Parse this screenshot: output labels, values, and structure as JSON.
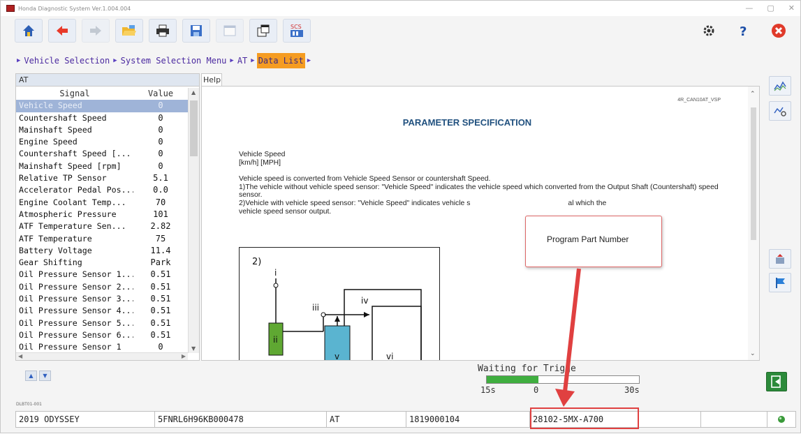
{
  "window": {
    "title": "Honda Diagnostic System Ver.1.004.004"
  },
  "toolbar": {
    "buttons": [
      {
        "name": "home-icon",
        "disabled": false
      },
      {
        "name": "back-arrow-icon",
        "disabled": false
      },
      {
        "name": "forward-arrow-icon",
        "disabled": true
      },
      {
        "name": "open-folder-icon",
        "disabled": false
      },
      {
        "name": "print-icon",
        "disabled": false
      },
      {
        "name": "save-icon",
        "disabled": false
      },
      {
        "name": "window-icon",
        "disabled": true
      },
      {
        "name": "export-icon",
        "disabled": false
      },
      {
        "name": "scs-icon",
        "disabled": false
      }
    ],
    "scs_label": "SCS"
  },
  "breadcrumb": {
    "items": [
      "Vehicle Selection",
      "System Selection Menu",
      "AT",
      "Data List"
    ],
    "active_index": 3
  },
  "signal_panel": {
    "title": "AT",
    "headers": {
      "signal": "Signal",
      "value": "Value"
    },
    "rows": [
      {
        "signal": "Vehicle Speed",
        "value": "0",
        "selected": true
      },
      {
        "signal": "Countershaft Speed",
        "value": "0"
      },
      {
        "signal": "Mainshaft Speed",
        "value": "0"
      },
      {
        "signal": "Engine Speed",
        "value": "0"
      },
      {
        "signal": "Countershaft Speed [...",
        "value": "0"
      },
      {
        "signal": "Mainshaft Speed [rpm]",
        "value": "0"
      },
      {
        "signal": "Relative TP Sensor",
        "value": "5.1"
      },
      {
        "signal": "Accelerator Pedal Pos...",
        "value": "0.0"
      },
      {
        "signal": "Engine Coolant Temp...",
        "value": "70"
      },
      {
        "signal": "Atmospheric Pressure",
        "value": "101"
      },
      {
        "signal": "ATF Temperature Sen...",
        "value": "2.82"
      },
      {
        "signal": "ATF Temperature",
        "value": "75"
      },
      {
        "signal": "Battery Voltage",
        "value": "11.4"
      },
      {
        "signal": "Gear Shifting",
        "value": "Park"
      },
      {
        "signal": "Oil Pressure Sensor 1...",
        "value": "0.51"
      },
      {
        "signal": "Oil Pressure Sensor 2...",
        "value": "0.51"
      },
      {
        "signal": "Oil Pressure Sensor 3...",
        "value": "0.51"
      },
      {
        "signal": "Oil Pressure Sensor 4...",
        "value": "0.51"
      },
      {
        "signal": "Oil Pressure Sensor 5...",
        "value": "0.51"
      },
      {
        "signal": "Oil Pressure Sensor 6...",
        "value": "0.51"
      },
      {
        "signal": "Oil Pressure Sensor 1",
        "value": "0"
      }
    ]
  },
  "help": {
    "tab_label": "Help",
    "doc_code": "4R_CAN10AT_VSP",
    "heading": "PARAMETER SPECIFICATION",
    "param_name": "Vehicle Speed",
    "param_unit": "[km/h] [MPH]",
    "para1": "Vehicle speed is converted from Vehicle Speed Sensor or countershaft Speed.",
    "para2": "1)The vehicle without vehicle speed sensor: \"Vehicle Speed\" indicates the vehicle speed which converted from the Output Shaft (Countershaft) speed sensor.",
    "para3_start": "2)Vehicle with vehicle speed sensor: \"Vehicle Speed\" indicates vehicle s",
    "para3_end": "al which the",
    "para3_line2": "vehicle speed sensor output.",
    "diagram": {
      "number": "2)",
      "labels": [
        "i",
        "ii",
        "iii",
        "iv",
        "v",
        "vi"
      ]
    }
  },
  "lower": {
    "code": "DLBT01-001",
    "trigger_label": "Waiting for Trigge",
    "trigger_fill_fraction": 0.34,
    "scale": {
      "left": "15s",
      "mid": "0",
      "right": "30s"
    }
  },
  "status_bar": {
    "model": "2019 ODYSSEY",
    "vin": "5FNRL6H96KB000478",
    "system": "AT",
    "number": "1819000104",
    "part_number": "28102-5MX-A700",
    "cell6": "",
    "cell7": ""
  },
  "annotation": {
    "callout_text": "Program Part Number",
    "color": "#e04040"
  }
}
